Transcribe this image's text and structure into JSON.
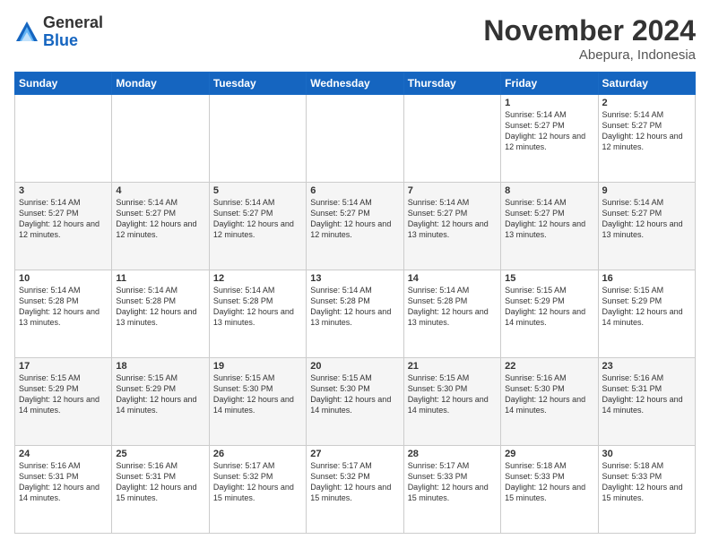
{
  "logo": {
    "general": "General",
    "blue": "Blue"
  },
  "header": {
    "month": "November 2024",
    "location": "Abepura, Indonesia"
  },
  "weekdays": [
    "Sunday",
    "Monday",
    "Tuesday",
    "Wednesday",
    "Thursday",
    "Friday",
    "Saturday"
  ],
  "weeks": [
    [
      null,
      null,
      null,
      null,
      null,
      {
        "day": "1",
        "sunrise": "5:14 AM",
        "sunset": "5:27 PM",
        "daylight": "12 hours and 12 minutes."
      },
      {
        "day": "2",
        "sunrise": "5:14 AM",
        "sunset": "5:27 PM",
        "daylight": "12 hours and 12 minutes."
      }
    ],
    [
      {
        "day": "3",
        "sunrise": "5:14 AM",
        "sunset": "5:27 PM",
        "daylight": "12 hours and 12 minutes."
      },
      {
        "day": "4",
        "sunrise": "5:14 AM",
        "sunset": "5:27 PM",
        "daylight": "12 hours and 12 minutes."
      },
      {
        "day": "5",
        "sunrise": "5:14 AM",
        "sunset": "5:27 PM",
        "daylight": "12 hours and 12 minutes."
      },
      {
        "day": "6",
        "sunrise": "5:14 AM",
        "sunset": "5:27 PM",
        "daylight": "12 hours and 12 minutes."
      },
      {
        "day": "7",
        "sunrise": "5:14 AM",
        "sunset": "5:27 PM",
        "daylight": "12 hours and 13 minutes."
      },
      {
        "day": "8",
        "sunrise": "5:14 AM",
        "sunset": "5:27 PM",
        "daylight": "12 hours and 13 minutes."
      },
      {
        "day": "9",
        "sunrise": "5:14 AM",
        "sunset": "5:27 PM",
        "daylight": "12 hours and 13 minutes."
      }
    ],
    [
      {
        "day": "10",
        "sunrise": "5:14 AM",
        "sunset": "5:28 PM",
        "daylight": "12 hours and 13 minutes."
      },
      {
        "day": "11",
        "sunrise": "5:14 AM",
        "sunset": "5:28 PM",
        "daylight": "12 hours and 13 minutes."
      },
      {
        "day": "12",
        "sunrise": "5:14 AM",
        "sunset": "5:28 PM",
        "daylight": "12 hours and 13 minutes."
      },
      {
        "day": "13",
        "sunrise": "5:14 AM",
        "sunset": "5:28 PM",
        "daylight": "12 hours and 13 minutes."
      },
      {
        "day": "14",
        "sunrise": "5:14 AM",
        "sunset": "5:28 PM",
        "daylight": "12 hours and 13 minutes."
      },
      {
        "day": "15",
        "sunrise": "5:15 AM",
        "sunset": "5:29 PM",
        "daylight": "12 hours and 14 minutes."
      },
      {
        "day": "16",
        "sunrise": "5:15 AM",
        "sunset": "5:29 PM",
        "daylight": "12 hours and 14 minutes."
      }
    ],
    [
      {
        "day": "17",
        "sunrise": "5:15 AM",
        "sunset": "5:29 PM",
        "daylight": "12 hours and 14 minutes."
      },
      {
        "day": "18",
        "sunrise": "5:15 AM",
        "sunset": "5:29 PM",
        "daylight": "12 hours and 14 minutes."
      },
      {
        "day": "19",
        "sunrise": "5:15 AM",
        "sunset": "5:30 PM",
        "daylight": "12 hours and 14 minutes."
      },
      {
        "day": "20",
        "sunrise": "5:15 AM",
        "sunset": "5:30 PM",
        "daylight": "12 hours and 14 minutes."
      },
      {
        "day": "21",
        "sunrise": "5:15 AM",
        "sunset": "5:30 PM",
        "daylight": "12 hours and 14 minutes."
      },
      {
        "day": "22",
        "sunrise": "5:16 AM",
        "sunset": "5:30 PM",
        "daylight": "12 hours and 14 minutes."
      },
      {
        "day": "23",
        "sunrise": "5:16 AM",
        "sunset": "5:31 PM",
        "daylight": "12 hours and 14 minutes."
      }
    ],
    [
      {
        "day": "24",
        "sunrise": "5:16 AM",
        "sunset": "5:31 PM",
        "daylight": "12 hours and 14 minutes."
      },
      {
        "day": "25",
        "sunrise": "5:16 AM",
        "sunset": "5:31 PM",
        "daylight": "12 hours and 15 minutes."
      },
      {
        "day": "26",
        "sunrise": "5:17 AM",
        "sunset": "5:32 PM",
        "daylight": "12 hours and 15 minutes."
      },
      {
        "day": "27",
        "sunrise": "5:17 AM",
        "sunset": "5:32 PM",
        "daylight": "12 hours and 15 minutes."
      },
      {
        "day": "28",
        "sunrise": "5:17 AM",
        "sunset": "5:33 PM",
        "daylight": "12 hours and 15 minutes."
      },
      {
        "day": "29",
        "sunrise": "5:18 AM",
        "sunset": "5:33 PM",
        "daylight": "12 hours and 15 minutes."
      },
      {
        "day": "30",
        "sunrise": "5:18 AM",
        "sunset": "5:33 PM",
        "daylight": "12 hours and 15 minutes."
      }
    ]
  ]
}
